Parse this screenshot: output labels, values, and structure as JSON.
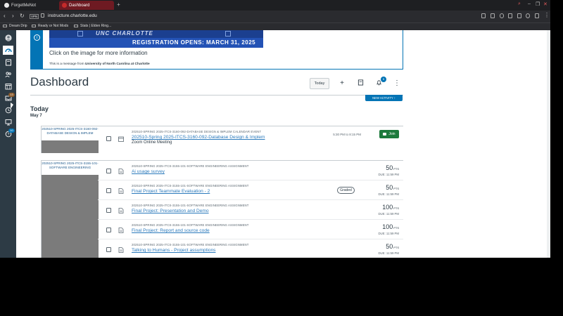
{
  "browser": {
    "tabs": [
      {
        "label": "ForgetMeNot"
      },
      {
        "label": "Dashboard"
      }
    ],
    "vpn_label": "VPN",
    "url": "instructure.charlotte.edu",
    "bookmarks": [
      {
        "label": "Dream Drip"
      },
      {
        "label": "Ready or Not Mods"
      },
      {
        "label": "Stats | Elden Ring..."
      }
    ]
  },
  "nav": {
    "items": [
      {
        "name": "account",
        "icon": "account-icon"
      },
      {
        "name": "dashboard",
        "icon": "dashboard-icon"
      },
      {
        "name": "courses",
        "icon": "courses-icon"
      },
      {
        "name": "groups",
        "icon": "groups-icon"
      },
      {
        "name": "calendar",
        "icon": "calendar-icon"
      },
      {
        "name": "inbox",
        "icon": "inbox-icon",
        "badge": "13"
      },
      {
        "name": "history",
        "icon": "history-icon"
      },
      {
        "name": "studio",
        "icon": "studio-icon"
      },
      {
        "name": "help",
        "icon": "help-icon",
        "badge": "10"
      }
    ]
  },
  "alert": {
    "banner_top": "UNC CHARLOTTE",
    "banner_reg": "REGISTRATION OPENS: MARCH 31, 2025",
    "title": "Click on the image for more information",
    "message_prefix": "This is a message from ",
    "message_org": "University of North Carolina at Charlotte"
  },
  "header": {
    "title": "Dashboard",
    "today_label": "Today",
    "notif_count": "5",
    "new_activity": "NEW ACTIVITY ↑"
  },
  "planner": {
    "day": "Today",
    "date": "May 7",
    "groups": [
      {
        "course": "202510-SPRING 2025-ITCS-3160-092-DATABASE DESIGN & IMPLEM",
        "items": [
          {
            "type": "202510-SPRING 2025-ITCS-3160-092-DATABASE DESIGN & IMPLEM CALENDAR EVENT",
            "title": "202510-Spring 2025-ITCS-3160-092-Database Design & Implem",
            "subtitle": "Zoom Online Meeting",
            "time": "5:30 PM to 8:15 PM",
            "join": "Join"
          }
        ]
      },
      {
        "course": "202510-SPRING 2025-ITCS-3155-101-SOFTWARE ENGINEERING",
        "items": [
          {
            "type": "202510-SPRING 2025-ITCS-3155-101-SOFTWARE ENGINEERING ASSIGNMENT",
            "title": "Ai usage survey",
            "points": "50",
            "pts_label": "PTS",
            "due": "DUE: 11:59 PM"
          },
          {
            "type": "202510-SPRING 2025-ITCS-3155-101-SOFTWARE ENGINEERING ASSIGNMENT",
            "title": "Final Project Teammate Evaluation - 2",
            "points": "50",
            "pts_label": "PTS",
            "due": "DUE: 11:59 PM",
            "badge": "Graded"
          },
          {
            "type": "202510-SPRING 2025-ITCS-3155-101-SOFTWARE ENGINEERING ASSIGNMENT",
            "title": "Final Project: Presentation and Demo",
            "points": "100",
            "pts_label": "PTS",
            "due": "DUE: 11:59 PM"
          },
          {
            "type": "202510-SPRING 2025-ITCS-3155-101-SOFTWARE ENGINEERING ASSIGNMENT",
            "title": "Final Project: Report and source code",
            "points": "100",
            "pts_label": "PTS",
            "due": "DUE: 11:59 PM"
          },
          {
            "type": "202510-SPRING 2025-ITCS-3155-101-SOFTWARE ENGINEERING ASSIGNMENT",
            "title": "Talking to Humans - Project assumptions",
            "points": "50",
            "pts_label": "PTS",
            "due": "DUE: 11:59 PM"
          }
        ]
      }
    ]
  },
  "colors": {
    "nav_bg": "#2d3b45",
    "brand_blue": "#0374b5",
    "join_green": "#1d7a3c",
    "link": "#2b7abc"
  }
}
